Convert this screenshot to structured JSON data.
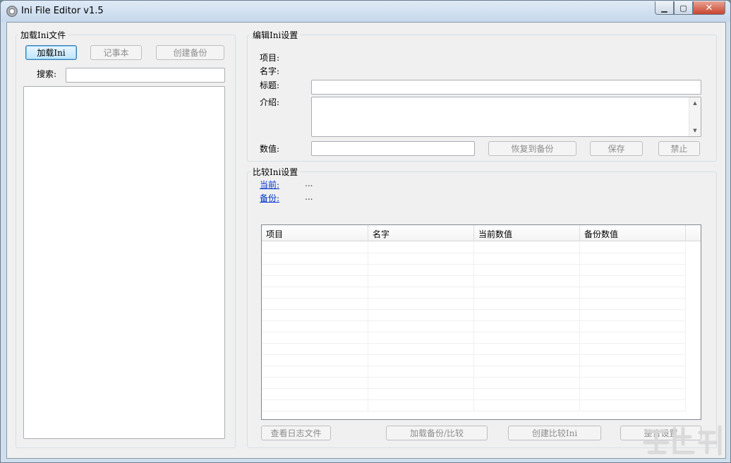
{
  "window": {
    "title": "Ini File Editor v1.5",
    "controls": {
      "minimize": "▁",
      "maximize": "▢",
      "close": "✕"
    }
  },
  "load_panel": {
    "group_label": "加载Ini文件",
    "load_button": "加载Ini",
    "notepad_button": "记事本",
    "backup_button": "创建备份",
    "search_label": "搜索:",
    "search_value": ""
  },
  "edit_panel": {
    "group_label": "编辑Ini设置",
    "item_label": "项目:",
    "name_label": "名字:",
    "title_label": "标题:",
    "title_value": "",
    "intro_label": "介绍:",
    "intro_value": "",
    "value_label": "数值:",
    "value_value": "",
    "restore_button": "恢复到备份",
    "save_button": "保存",
    "disable_button": "禁止"
  },
  "compare_panel": {
    "group_label": "比较Ini设置",
    "current_link": "当前:",
    "current_value": "...",
    "backup_link": "备份:",
    "backup_value": "...",
    "columns": [
      "项目",
      "名字",
      "当前数值",
      "备份数值"
    ],
    "view_log_button": "查看日志文件",
    "load_backup_compare_button": "加载备份/比较",
    "create_compare_button": "创建比较Ini",
    "merge_button": "整合设置"
  },
  "colors": {
    "window_frame": "#cfdfee",
    "client_bg": "#f0f0f0",
    "link": "#0033cc",
    "close_button": "#c7442d"
  }
}
